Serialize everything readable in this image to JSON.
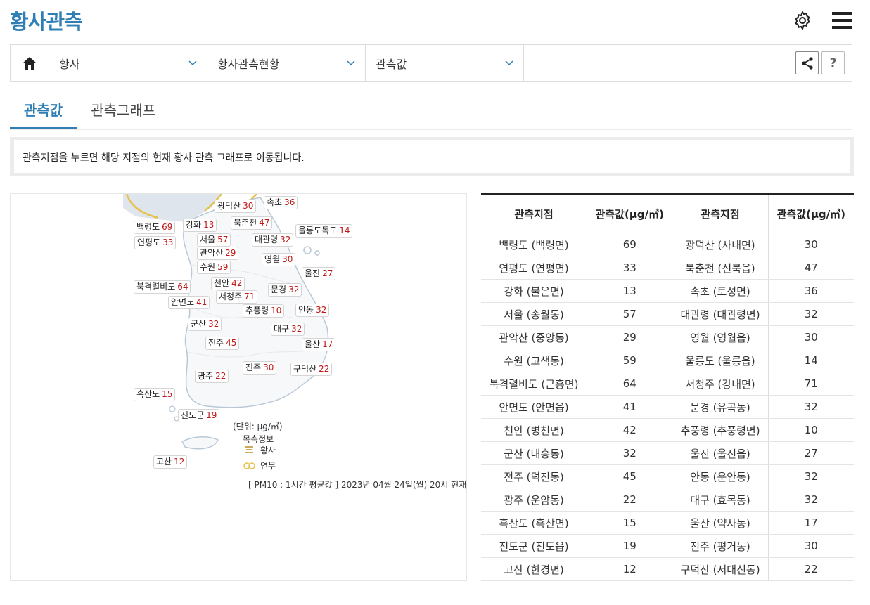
{
  "app_title": "황사관측",
  "breadcrumb": {
    "level1": "황사",
    "level2": "황사관측현황",
    "level3": "관측값"
  },
  "tabs": [
    "관측값",
    "관측그래프"
  ],
  "notice": "관측지점을 누르면 해당 지점의 현재 황사 관측 그래프로 이동됩니다.",
  "map": {
    "unit": "(단위: μg/㎥)",
    "legend_title": "목측정보",
    "legend_items": [
      "황사",
      "연무"
    ],
    "footnote": "[ PM10 : 1시간 평균값 ] 2023년 04월 24일(월) 20시 현재",
    "labels": [
      {
        "name": "광덕산",
        "value": "30"
      },
      {
        "name": "속초",
        "value": "36"
      },
      {
        "name": "백령도",
        "value": "69"
      },
      {
        "name": "강화",
        "value": "13"
      },
      {
        "name": "북춘천",
        "value": "47"
      },
      {
        "name": "울릉도독도",
        "value": "14"
      },
      {
        "name": "연평도",
        "value": "33"
      },
      {
        "name": "서울",
        "value": "57"
      },
      {
        "name": "대관령",
        "value": "32"
      },
      {
        "name": "관악산",
        "value": "29"
      },
      {
        "name": "영월",
        "value": "30"
      },
      {
        "name": "수원",
        "value": "59"
      },
      {
        "name": "울진",
        "value": "27"
      },
      {
        "name": "북격렬비도",
        "value": "64"
      },
      {
        "name": "천안",
        "value": "42"
      },
      {
        "name": "문경",
        "value": "32"
      },
      {
        "name": "서청주",
        "value": "71"
      },
      {
        "name": "안면도",
        "value": "41"
      },
      {
        "name": "추풍령",
        "value": "10"
      },
      {
        "name": "안동",
        "value": "32"
      },
      {
        "name": "군산",
        "value": "32"
      },
      {
        "name": "대구",
        "value": "32"
      },
      {
        "name": "전주",
        "value": "45"
      },
      {
        "name": "울산",
        "value": "17"
      },
      {
        "name": "진주",
        "value": "30"
      },
      {
        "name": "구덕산",
        "value": "22"
      },
      {
        "name": "광주",
        "value": "22"
      },
      {
        "name": "흑산도",
        "value": "15"
      },
      {
        "name": "진도군",
        "value": "19"
      },
      {
        "name": "고산",
        "value": "12"
      }
    ]
  },
  "table": {
    "headers": [
      "관측지점",
      "관측값(μg/㎥)",
      "관측지점",
      "관측값(μg/㎥)"
    ],
    "rows": [
      [
        "백령도 (백령면)",
        "69",
        "광덕산 (사내면)",
        "30"
      ],
      [
        "연평도 (연평면)",
        "33",
        "북춘천 (신북읍)",
        "47"
      ],
      [
        "강화 (불은면)",
        "13",
        "속초 (토성면)",
        "36"
      ],
      [
        "서울 (송월동)",
        "57",
        "대관령 (대관령면)",
        "32"
      ],
      [
        "관악산 (중앙동)",
        "29",
        "영월 (영월읍)",
        "30"
      ],
      [
        "수원 (고색동)",
        "59",
        "울릉도 (울릉읍)",
        "14"
      ],
      [
        "북격렬비도 (근흥면)",
        "64",
        "서청주 (강내면)",
        "71"
      ],
      [
        "안면도 (안면읍)",
        "41",
        "문경 (유곡동)",
        "32"
      ],
      [
        "천안 (병천면)",
        "42",
        "추풍령 (추풍령면)",
        "10"
      ],
      [
        "군산 (내흥동)",
        "32",
        "울진 (울진읍)",
        "27"
      ],
      [
        "전주 (덕진동)",
        "45",
        "안동 (운안동)",
        "32"
      ],
      [
        "광주 (운암동)",
        "22",
        "대구 (효목동)",
        "32"
      ],
      [
        "흑산도 (흑산면)",
        "15",
        "울산 (약사동)",
        "17"
      ],
      [
        "진도군 (진도읍)",
        "19",
        "진주 (평거동)",
        "30"
      ],
      [
        "고산 (한경면)",
        "12",
        "구덕산 (서대신동)",
        "22"
      ]
    ]
  }
}
